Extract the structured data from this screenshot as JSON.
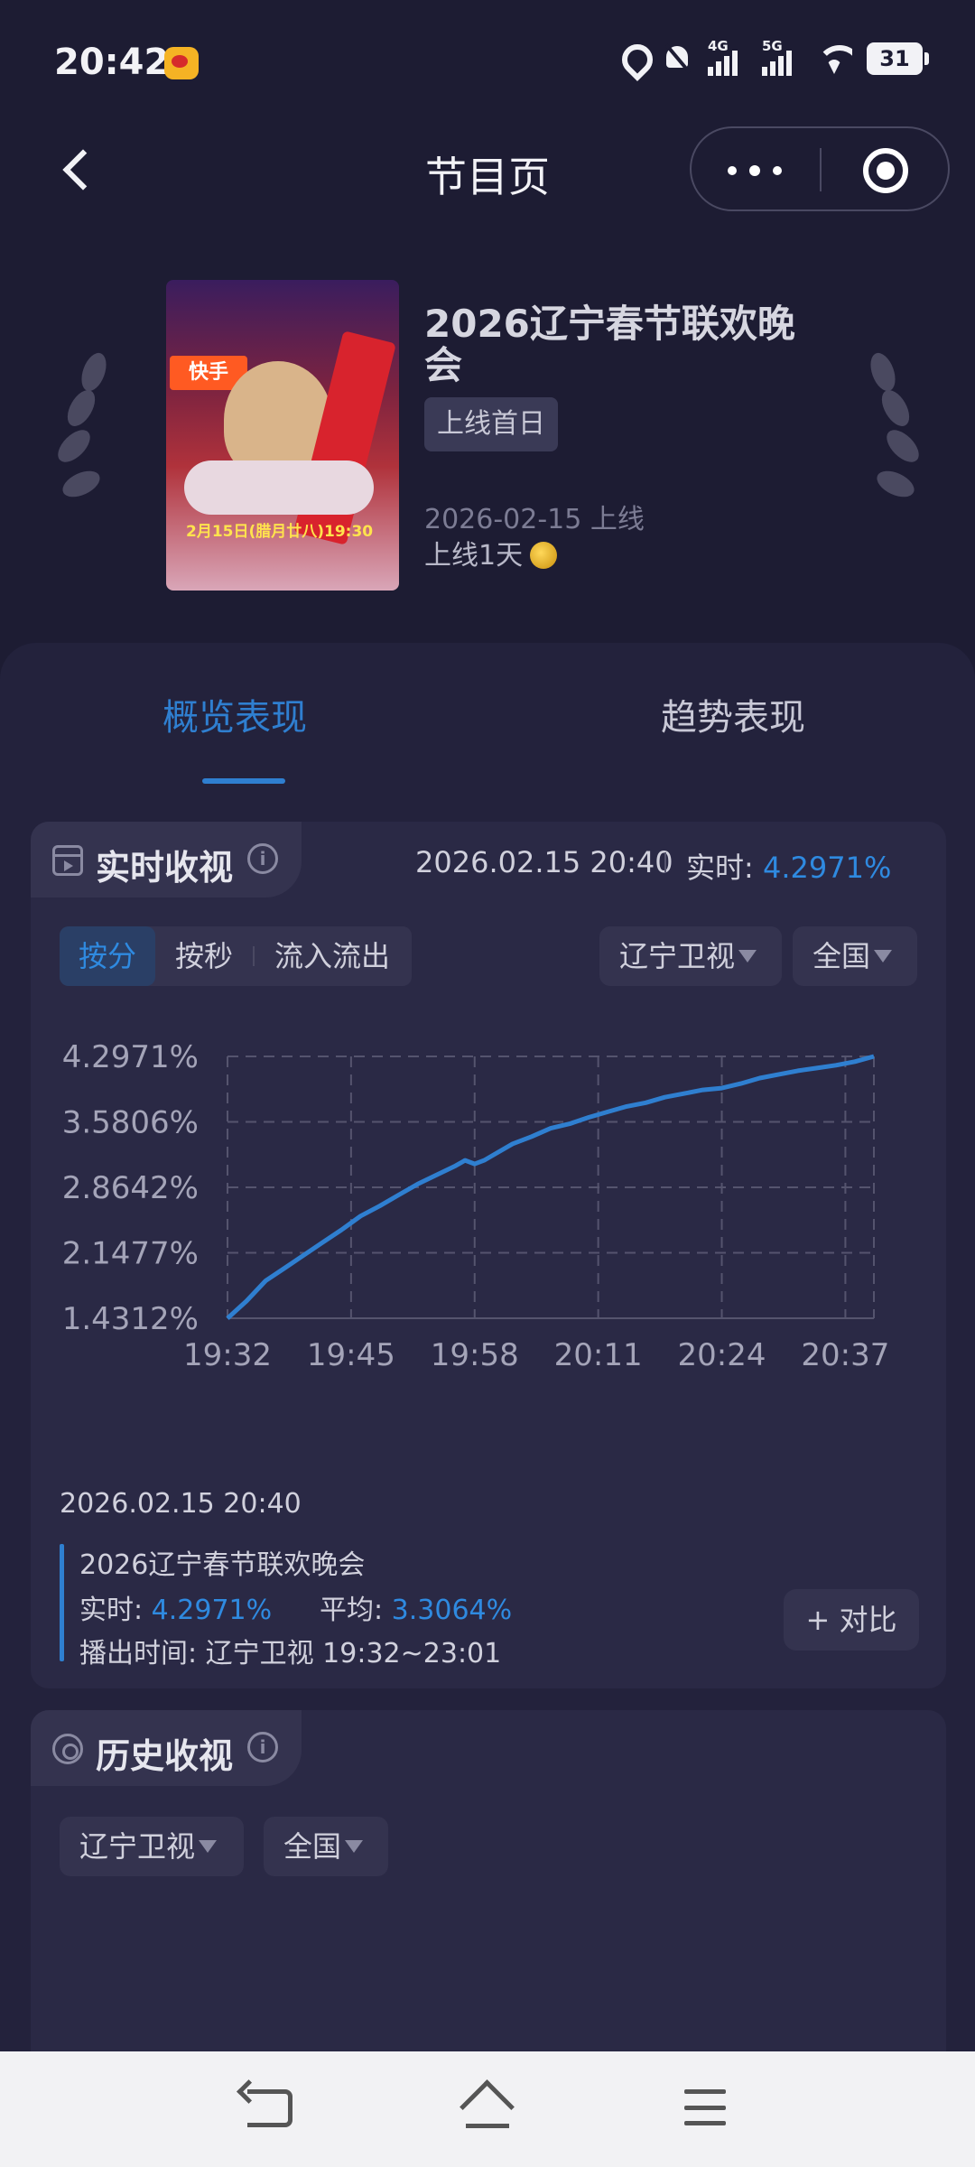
{
  "status_bar": {
    "time": "20:42",
    "network1": "4G",
    "network2": "5G",
    "battery": "31"
  },
  "nav": {
    "title": "节目页"
  },
  "program": {
    "title": "2026辽宁春节联欢晚会",
    "badge": "上线首日",
    "release": "2026-02-15 上线",
    "online_days": "上线1天",
    "poster_brand": "快手",
    "poster_date": "2月15日(腊月廿八)19:30"
  },
  "tabs": {
    "overview": "概览表现",
    "trend": "趋势表现"
  },
  "realtime": {
    "title": "实时收视",
    "timestamp": "2026.02.15 20:40",
    "rt_label": "实时: ",
    "rt_value": "4.2971%",
    "segments": [
      "按分",
      "按秒",
      "流入流出"
    ],
    "channel": "辽宁卫视",
    "region": "全国",
    "legend": {
      "date": "2026.02.15 20:40",
      "name": "2026辽宁春节联欢晚会",
      "rt_label": "实时: ",
      "rt_value": "4.2971%",
      "avg_label": "平均: ",
      "avg_value": "3.3064%",
      "airtime": "播出时间:  辽宁卫视 19:32~23:01"
    },
    "compare": "+ 对比"
  },
  "history": {
    "title": "历史收视",
    "channel": "辽宁卫视",
    "region": "全国"
  },
  "colors": {
    "accent": "#2f7fd0",
    "background": "#1d1c33"
  },
  "chart_data": {
    "type": "line",
    "y_ticks": [
      "4.2971%",
      "3.5806%",
      "2.8642%",
      "2.1477%",
      "1.4312%"
    ],
    "x_ticks": [
      "19:32",
      "19:45",
      "19:58",
      "20:11",
      "20:24",
      "20:37"
    ],
    "ylim": [
      1.4312,
      4.2971
    ],
    "xlim": [
      "19:32",
      "20:40"
    ],
    "grid": true,
    "series": [
      {
        "name": "2026辽宁春节联欢晚会",
        "x": [
          "19:32",
          "19:34",
          "19:36",
          "19:38",
          "19:40",
          "19:42",
          "19:44",
          "19:46",
          "19:48",
          "19:50",
          "19:52",
          "19:54",
          "19:56",
          "19:57",
          "19:58",
          "19:59",
          "20:00",
          "20:02",
          "20:04",
          "20:06",
          "20:08",
          "20:10",
          "20:12",
          "20:14",
          "20:16",
          "20:18",
          "20:20",
          "20:22",
          "20:24",
          "20:26",
          "20:28",
          "20:30",
          "20:32",
          "20:34",
          "20:36",
          "20:38",
          "20:40"
        ],
        "values": [
          1.43,
          1.62,
          1.84,
          1.98,
          2.12,
          2.26,
          2.4,
          2.55,
          2.66,
          2.78,
          2.9,
          3.0,
          3.1,
          3.16,
          3.12,
          3.16,
          3.22,
          3.34,
          3.42,
          3.51,
          3.56,
          3.63,
          3.69,
          3.75,
          3.79,
          3.85,
          3.89,
          3.93,
          3.95,
          4.0,
          4.06,
          4.1,
          4.14,
          4.17,
          4.2,
          4.24,
          4.2971
        ]
      }
    ]
  }
}
